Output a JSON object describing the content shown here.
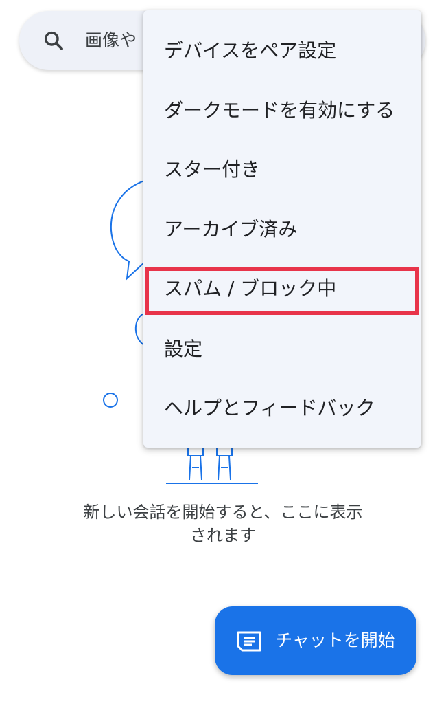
{
  "search": {
    "placeholder": "画像や",
    "icon": "search-icon"
  },
  "menu": {
    "items": [
      {
        "label": "デバイスをペア設定"
      },
      {
        "label": "ダークモードを有効にする"
      },
      {
        "label": "スター付き"
      },
      {
        "label": "アーカイブ済み"
      },
      {
        "label": "スパム / ブロック中"
      },
      {
        "label": "設定"
      },
      {
        "label": "ヘルプとフィードバック"
      }
    ]
  },
  "empty_state": {
    "line1": "新しい会話を開始すると、ここに表示",
    "line2": "されます"
  },
  "fab": {
    "label": "チャットを開始",
    "icon": "message-icon"
  },
  "colors": {
    "accent": "#1a73e8",
    "highlight": "#e8344a",
    "illustration_stroke": "#1a73e8",
    "menu_bg": "#f2f5fb",
    "search_bg": "#eef1f8"
  }
}
